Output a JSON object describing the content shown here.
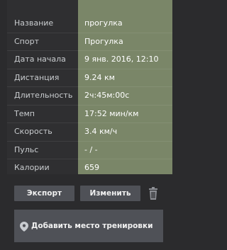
{
  "details": [
    {
      "label": "Название",
      "value": "прогулка"
    },
    {
      "label": "Спорт",
      "value": "Прогулка"
    },
    {
      "label": "Дата начала",
      "value": "9 янв. 2016, 12:10"
    },
    {
      "label": "Дистанция",
      "value": "9.24 км"
    },
    {
      "label": "Длительность",
      "value": "2ч:45м:00с"
    },
    {
      "label": "Темп",
      "value": "17:52 мин/км"
    },
    {
      "label": "Скорость",
      "value": "3.4 км/ч"
    },
    {
      "label": "Пульс",
      "value": "- / -"
    },
    {
      "label": "Калории",
      "value": "659"
    }
  ],
  "actions": {
    "export_label": "Экспорт",
    "edit_label": "Изменить",
    "delete_icon": "trash-icon"
  },
  "place": {
    "label": "Добавить место тренировки",
    "icon": "map-pin-icon"
  },
  "colors": {
    "background": "#2b2b2d",
    "value_column": "#7a8668",
    "button": "#4f5157"
  }
}
